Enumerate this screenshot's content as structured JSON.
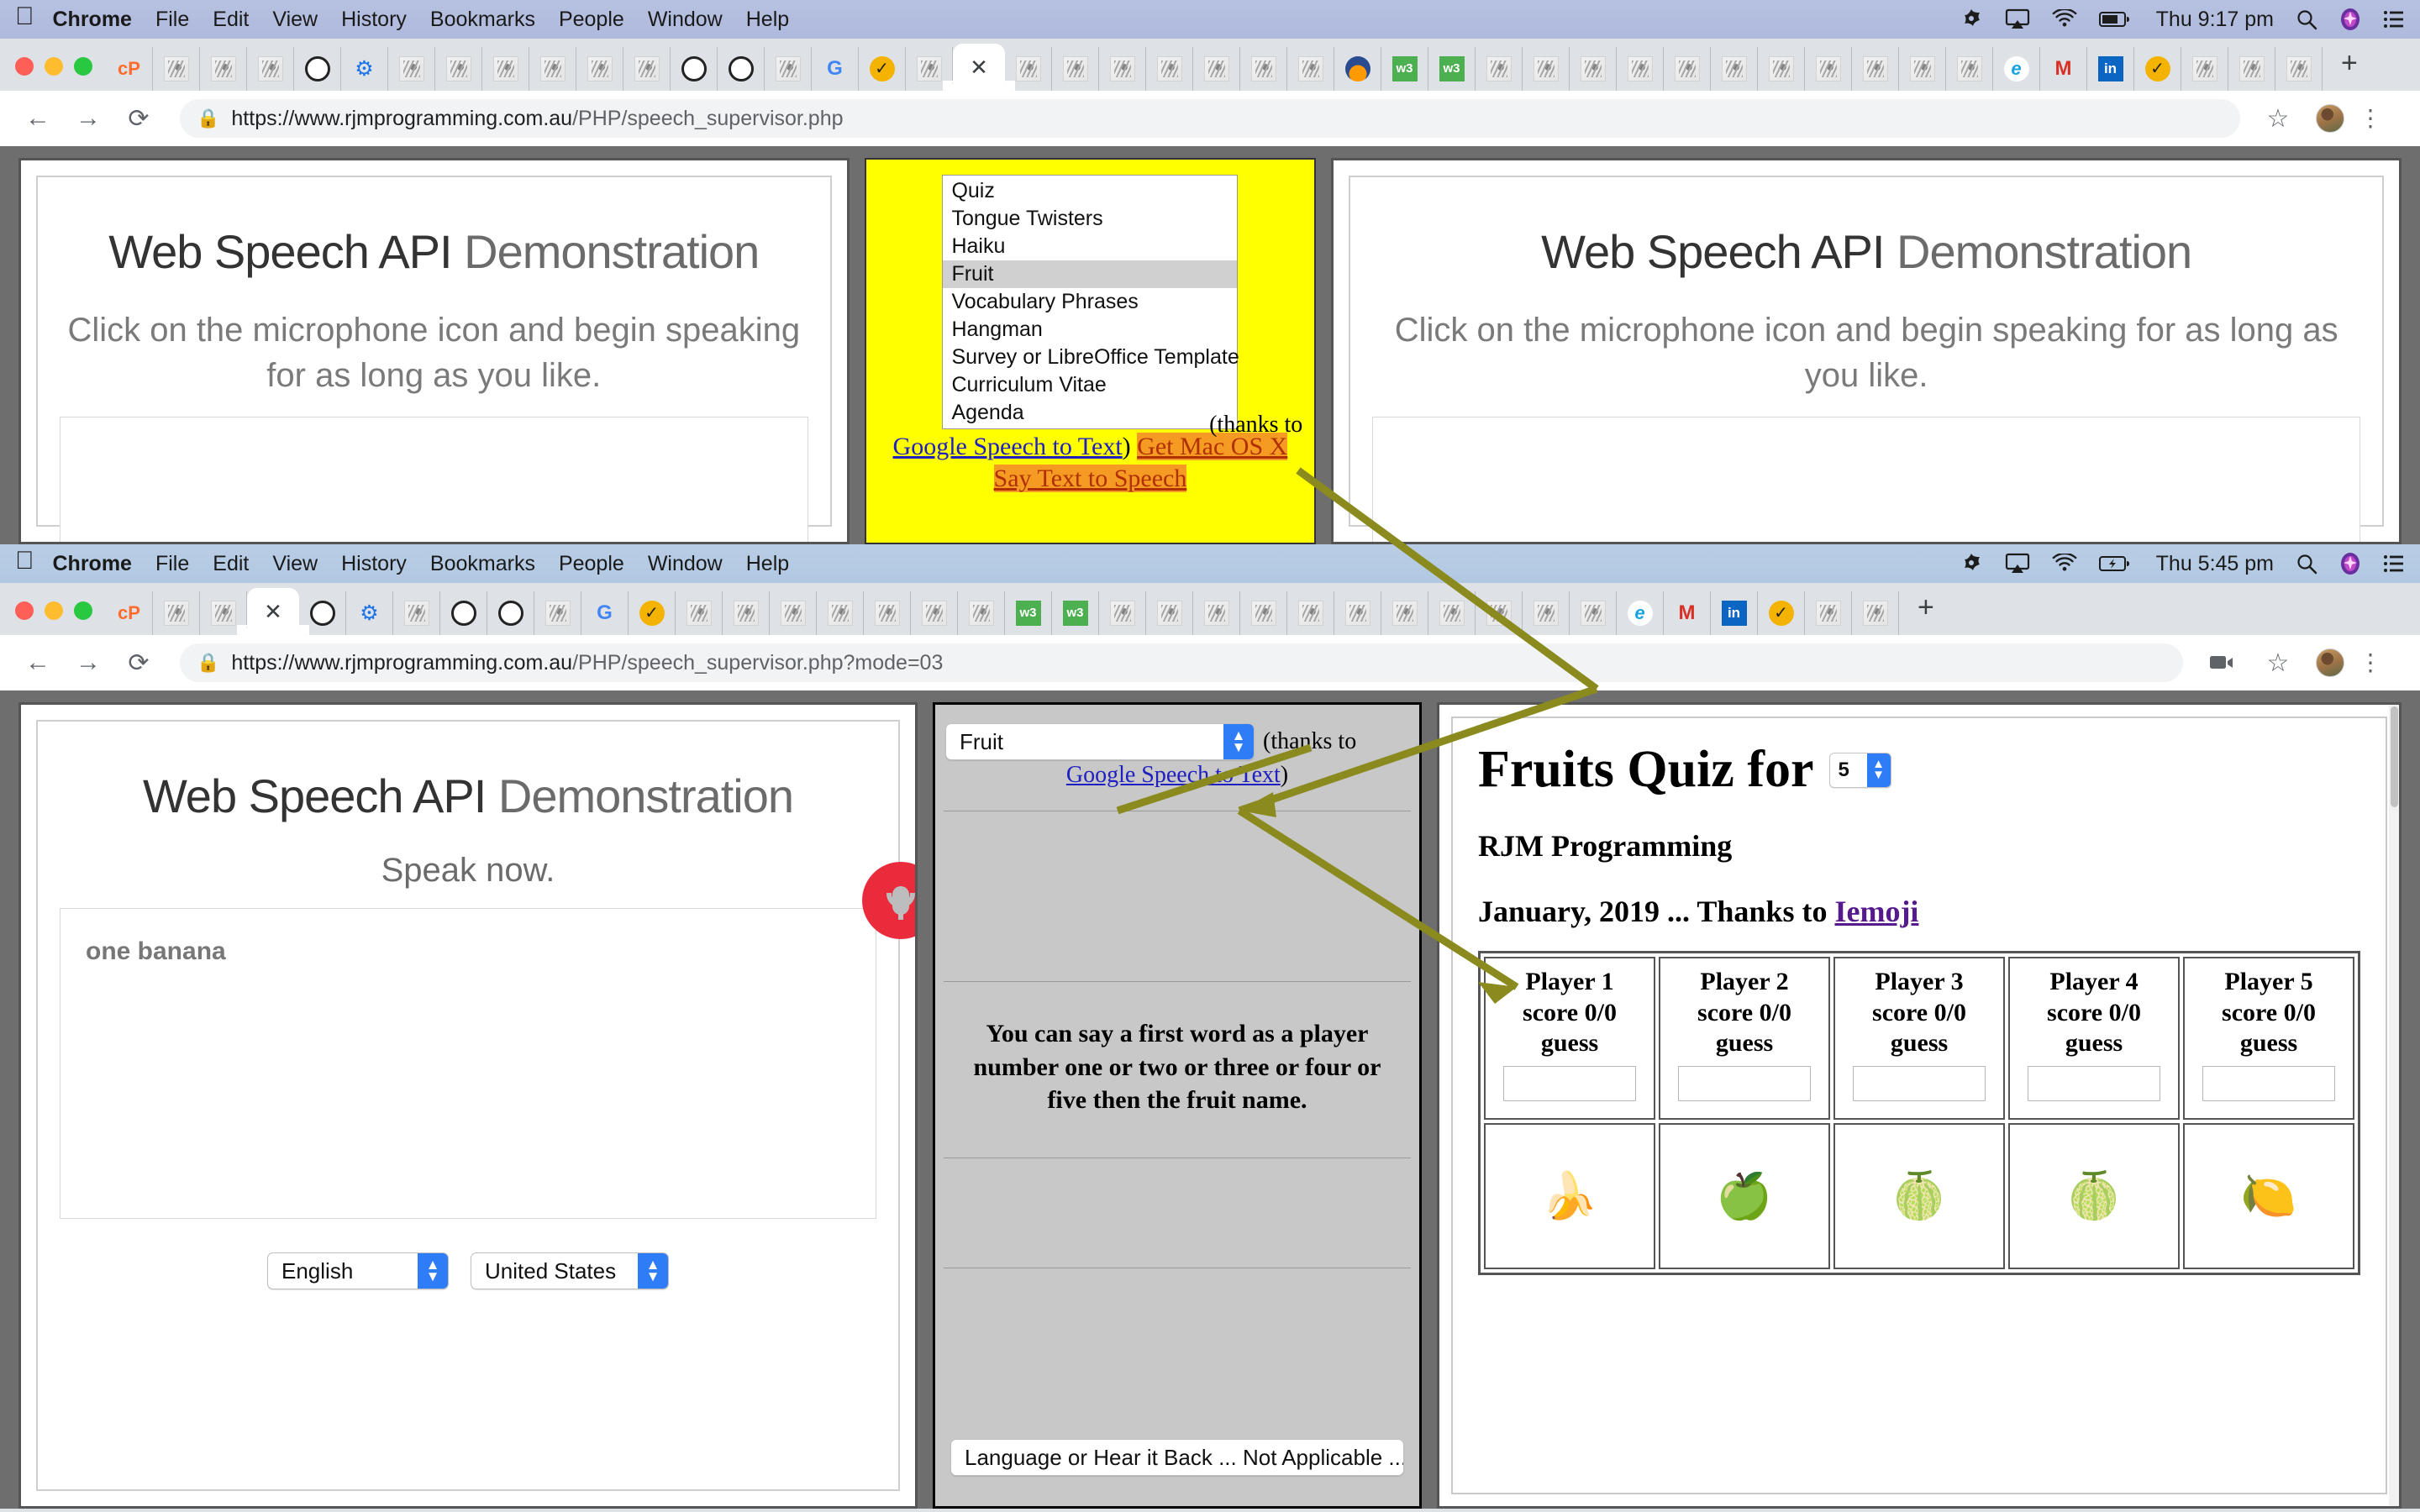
{
  "menubar_top": {
    "apple": "",
    "items": [
      "Chrome",
      "File",
      "Edit",
      "View",
      "History",
      "Bookmarks",
      "People",
      "Window",
      "Help"
    ],
    "clock": "Thu 9:17 pm",
    "status_icons": [
      "airfoil-icon",
      "airplay-icon",
      "wifi-icon",
      "battery-icon",
      "search-icon",
      "siri-icon",
      "notification-center-icon"
    ]
  },
  "menubar_bottom": {
    "apple": "",
    "items": [
      "Chrome",
      "File",
      "Edit",
      "View",
      "History",
      "Bookmarks",
      "People",
      "Window",
      "Help"
    ],
    "clock": "Thu 5:45 pm",
    "status_icons": [
      "airfoil-icon",
      "airplay-icon",
      "wifi-icon",
      "battery-charging-icon",
      "search-icon",
      "siri-icon",
      "notification-center-icon"
    ]
  },
  "window_top": {
    "url": "https://www.rjmprogramming.com.au/PHP/speech_supervisor.php",
    "url_host": "https://www.rjmprogramming.com.au",
    "url_path": "/PHP/speech_supervisor.php",
    "new_tab_label": "+",
    "nav": {
      "back": "←",
      "forward": "→",
      "reload": "⟳"
    },
    "toolbar_right": [
      "bookmark-star-icon",
      "profile-avatar",
      "chrome-menu-icon"
    ]
  },
  "window_bottom": {
    "url": "https://www.rjmprogramming.com.au/PHP/speech_supervisor.php?mode=03",
    "url_host": "https://www.rjmprogramming.com.au",
    "url_path": "/PHP/speech_supervisor.php?mode=03",
    "new_tab_label": "+",
    "nav": {
      "back": "←",
      "forward": "→",
      "reload": "⟳"
    },
    "toolbar_right": [
      "cast-icon",
      "bookmark-star-icon",
      "profile-avatar",
      "chrome-menu-icon"
    ]
  },
  "speech_panel": {
    "title_strong": "Web Speech API",
    "title_light": " Demonstration",
    "subtitle": "Click on the microphone icon and begin speaking for as long as you like.",
    "speak_now": "Speak now.",
    "transcript": "one banana",
    "mic_icon": "microphone-icon",
    "language_select": "English",
    "country_select": "United States"
  },
  "mid_panel": {
    "topic_select": "Fruit",
    "thanks_prefix": "(thanks to",
    "google_link": "Google Speech to Text",
    "thanks_suffix": ")",
    "instructions": "You can say a first word as a player number one or two or three or four or five then the fruit name.",
    "hear_select": "Language or Hear it Back ... Not Applicable ..."
  },
  "yellow_panel": {
    "options": [
      "Quiz",
      "Tongue Twisters",
      "Haiku",
      "Fruit",
      "Vocabulary Phrases",
      "Hangman",
      "Survey or LibreOffice Template",
      "Curriculum Vitae",
      "Agenda"
    ],
    "selected": "Fruit",
    "thanks_prefix": "(thanks to",
    "google_link": "Google Speech to Text",
    "thanks_suffix": ")",
    "mac_link_line1": "Get Mac OS X",
    "mac_link_line2": "Say Text to Speech"
  },
  "quiz": {
    "heading": "Fruits Quiz for",
    "player_count": "5",
    "org": "RJM Programming",
    "date_line_prefix": "January, 2019 ... Thanks to ",
    "iemoji_link": "Iemoji",
    "players": [
      {
        "name": "Player 1",
        "score": "score 0/0",
        "guess_label": "guess",
        "guess_value": "",
        "fruit": "🍌",
        "fruit_name": "banana-icon"
      },
      {
        "name": "Player 2",
        "score": "score 0/0",
        "guess_label": "guess",
        "guess_value": "",
        "fruit": "🍏",
        "fruit_name": "green-apple-icon"
      },
      {
        "name": "Player 3",
        "score": "score 0/0",
        "guess_label": "guess",
        "guess_value": "",
        "fruit": "🍈",
        "fruit_name": "melon-icon"
      },
      {
        "name": "Player 4",
        "score": "score 0/0",
        "guess_label": "guess",
        "guess_value": "",
        "fruit": "🍈",
        "fruit_name": "melon-icon"
      },
      {
        "name": "Player 5",
        "score": "score 0/0",
        "guess_label": "guess",
        "guess_value": "",
        "fruit": "🍋",
        "fruit_name": "lemon-icon"
      }
    ]
  },
  "colors": {
    "yellow": "#ffff00",
    "orange_highlight": "#f59a23",
    "mic_red": "#ea2b3c",
    "select_blue": "#2f7df6",
    "arrow_olive": "#8a8a1e",
    "viewport_gray": "#6e6e6e",
    "mid_panel_gray": "#c8c8c8"
  }
}
